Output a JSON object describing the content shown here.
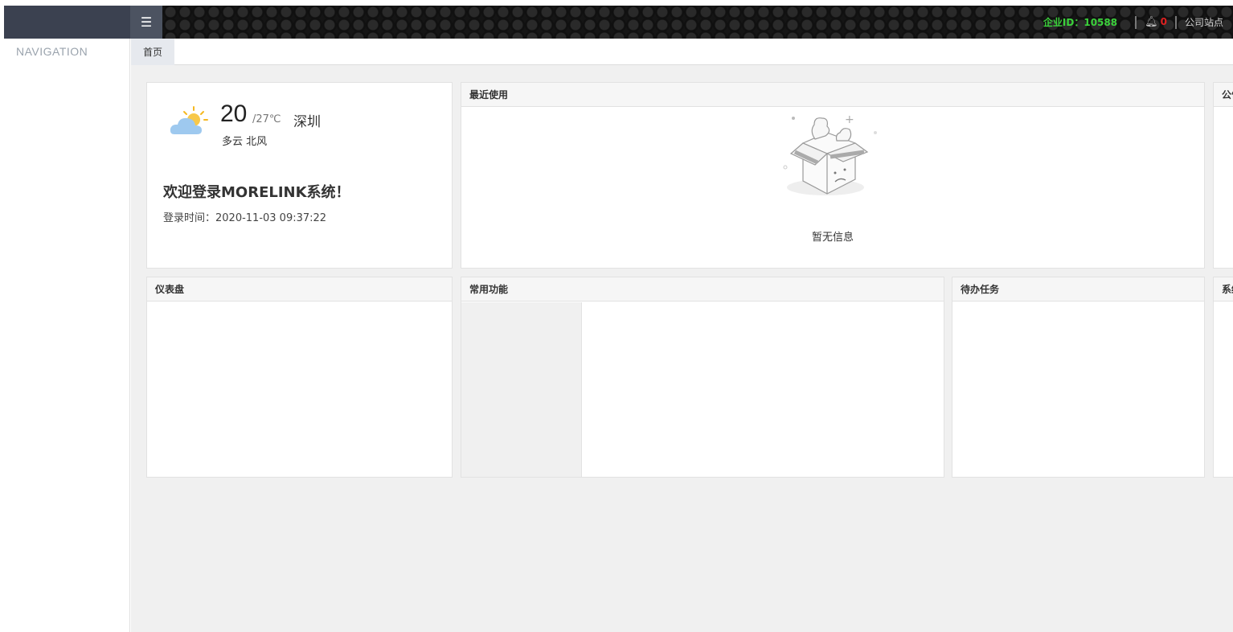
{
  "header": {
    "menu_icon": "hamburger-icon",
    "corp_id": "企业ID：10588",
    "notification_count": "0",
    "site_link": "公司站点"
  },
  "sidebar": {
    "title": "NAVIGATION"
  },
  "tabs": [
    {
      "label": "首页"
    }
  ],
  "weather": {
    "temp": "20",
    "range": "/27℃",
    "city": "深圳",
    "condition": "多云 北风"
  },
  "welcome": {
    "title": "欢迎登录MORELINK系统！",
    "login_time": "登录时间：2020-11-03 09:37:22"
  },
  "panels": {
    "recent": "最近使用",
    "empty_text": "暂无信息",
    "notice": "公告",
    "dashboard": "仪表盘",
    "common": "常用功能",
    "todo": "待办任务",
    "system": "系统"
  },
  "colors": {
    "corp_id": "#3bd23b",
    "notification": "#e02020",
    "brand_bg": "#3b4150"
  }
}
